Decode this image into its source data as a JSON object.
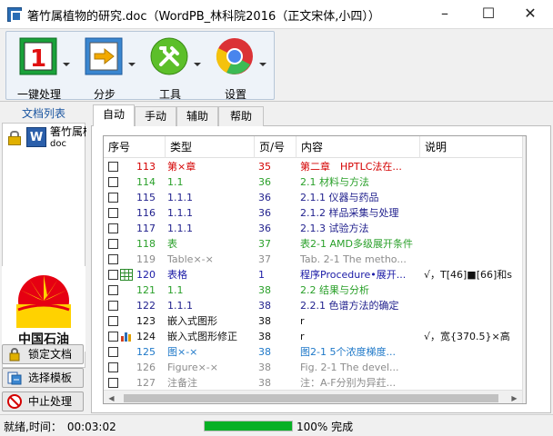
{
  "window": {
    "title": "箸竹属植物的研究.doc（WordPB_林科院2016（正文宋体,小四））"
  },
  "toolbar": {
    "items": [
      {
        "label": "一键处理",
        "icon": "number-one-icon"
      },
      {
        "label": "分步",
        "icon": "arrow-right-icon"
      },
      {
        "label": "工具",
        "icon": "tools-icon"
      },
      {
        "label": "设置",
        "icon": "chrome-icon"
      }
    ]
  },
  "sidebar": {
    "header": "文档列表",
    "doc_name_line1": "箸竹属植",
    "doc_name_line2": "doc",
    "logo_text": "中国石油",
    "buttons": [
      {
        "label": "锁定文档",
        "icon": "lock-icon"
      },
      {
        "label": "选择模板",
        "icon": "template-icon"
      },
      {
        "label": "中止处理",
        "icon": "stop-icon"
      }
    ]
  },
  "tabs": [
    "自动",
    "手动",
    "辅助",
    "帮助"
  ],
  "table": {
    "columns": [
      "序号",
      "类型",
      "页/号",
      "内容",
      "说明"
    ],
    "rows": [
      {
        "num": "113",
        "type": "第×章",
        "page": "35",
        "content": "第二章　HPTLC法在...",
        "note": "",
        "color": "#d40000",
        "icon": ""
      },
      {
        "num": "114",
        "type": "1.1",
        "page": "36",
        "content": "2.1 材料与方法",
        "note": "",
        "color": "#2aa02a",
        "icon": ""
      },
      {
        "num": "115",
        "type": "1.1.1",
        "page": "36",
        "content": "2.1.1 仪器与药品",
        "note": "",
        "color": "#1e1e8c",
        "icon": ""
      },
      {
        "num": "116",
        "type": "1.1.1",
        "page": "36",
        "content": "2.1.2 样品采集与处理",
        "note": "",
        "color": "#1e1e8c",
        "icon": ""
      },
      {
        "num": "117",
        "type": "1.1.1",
        "page": "36",
        "content": "2.1.3 试验方法",
        "note": "",
        "color": "#1e1e8c",
        "icon": ""
      },
      {
        "num": "118",
        "type": "表",
        "page": "37",
        "content": "表2-1 AMD多级展开条件",
        "note": "",
        "color": "#2aa02a",
        "icon": ""
      },
      {
        "num": "119",
        "type": "Table×-×",
        "page": "37",
        "content": "Tab. 2-1 The metho...",
        "note": "",
        "color": "#8c8c8c",
        "icon": ""
      },
      {
        "num": "120",
        "type": "表格",
        "page": "1",
        "content": "程序Procedure•展开...",
        "note": "√，T[46]■[66]和s",
        "color": "#1a1aa6",
        "icon": "table"
      },
      {
        "num": "121",
        "type": "1.1",
        "page": "38",
        "content": "2.2 结果与分析",
        "note": "",
        "color": "#2aa02a",
        "icon": ""
      },
      {
        "num": "122",
        "type": "1.1.1",
        "page": "38",
        "content": "2.2.1 色谱方法的确定",
        "note": "",
        "color": "#1e1e8c",
        "icon": ""
      },
      {
        "num": "123",
        "type": "嵌入式图形",
        "page": "38",
        "content": "r",
        "note": "",
        "color": "#111111",
        "icon": ""
      },
      {
        "num": "124",
        "type": "嵌入式图形修正",
        "page": "38",
        "content": "r",
        "note": "√，宽{370.5}×高",
        "color": "#111111",
        "icon": "chart"
      },
      {
        "num": "125",
        "type": "图×-×",
        "page": "38",
        "content": "图2-1 5个浓度梯度...",
        "note": "",
        "color": "#1e78c8",
        "icon": ""
      },
      {
        "num": "126",
        "type": "Figure×-×",
        "page": "38",
        "content": "Fig. 2-1 The devel...",
        "note": "",
        "color": "#8c8c8c",
        "icon": ""
      },
      {
        "num": "127",
        "type": "注备注",
        "page": "38",
        "content": "注：A-F分别为异荭...",
        "note": "",
        "color": "#8c8c8c",
        "icon": ""
      }
    ]
  },
  "status": {
    "text": "就绪,时间：　00:03:02",
    "progress_fraction": 1.0,
    "progress_text": "100%  完成",
    "progress_color": "#06b025"
  }
}
